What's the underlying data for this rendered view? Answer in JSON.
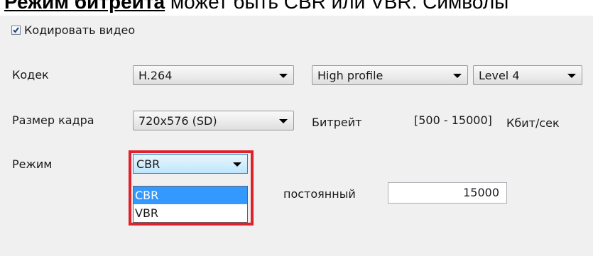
{
  "caption": {
    "highlight": "Режим битрейта",
    "rest": " может быть CBR или VBR. Символы"
  },
  "encode_video": {
    "label": "Кодировать видео",
    "checked": true
  },
  "codec": {
    "label": "Кодек",
    "value": "H.264",
    "profile": "High profile",
    "level": "Level 4"
  },
  "frame_size": {
    "label": "Размер кадра",
    "value": "720x576 (SD)"
  },
  "bitrate": {
    "label": "Битрейт",
    "range": "[500 - 15000]",
    "unit": "Кбит/сек"
  },
  "mode": {
    "label": "Режим",
    "value": "CBR",
    "options": [
      "CBR",
      "VBR"
    ],
    "selected_index": 0
  },
  "constant": {
    "label": "постоянный",
    "value": "15000"
  },
  "colors": {
    "highlight_frame": "#e0202a",
    "selection": "#3399ff"
  },
  "icons": {
    "checkbox": "checkmark-icon",
    "dropdown": "chevron-down-icon"
  }
}
